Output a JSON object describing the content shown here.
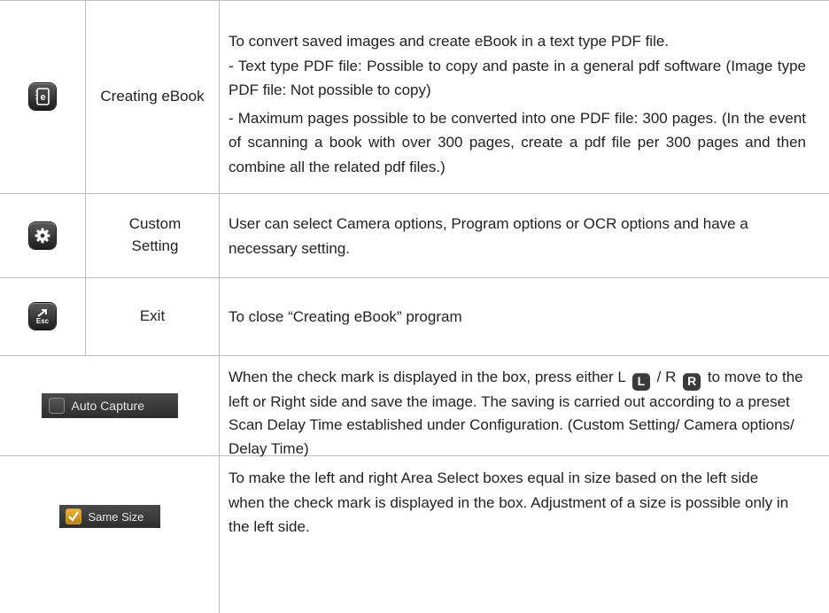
{
  "rows": [
    {
      "icon": "ebook-icon",
      "label": "Creating eBook",
      "desc": [
        "To convert saved images and create eBook in a text type PDF file.",
        "- Text type PDF file: Possible to copy and paste in a general pdf software (Image type PDF file: Not possible to copy)",
        "- Maximum pages possible to be converted into one PDF file: 300 pages. (In the event of scanning a book with over 300 pages, create a pdf file per 300 pages and then combine all the related pdf files.)"
      ]
    },
    {
      "icon": "gear-icon",
      "label": "Custom Setting",
      "desc": "User can select Camera options, Program options or OCR options and have a necessary setting."
    },
    {
      "icon": "esc-exit-icon",
      "label": "Exit",
      "desc": "To close “Creating eBook” program"
    },
    {
      "control_label": "Auto Capture",
      "checked": false,
      "desc_part1": "When the check mark is displayed in the box, press either L",
      "key_left": "L",
      "sep": "/ R",
      "key_right": "R",
      "desc_part2": "to move to the left or Right side and save the image. The saving is carried out according to a preset Scan Delay Time established under Configuration.  (Custom Setting/ Camera options/ Delay Time)"
    },
    {
      "control_label": "Same Size",
      "checked": true,
      "desc": "To make the left and right Area Select boxes equal in size based on the left side when the check mark is displayed in the box. Adjustment of a size is possible only in the left side."
    }
  ],
  "colors": {
    "grid": "#bdbdbd",
    "checkbox_checked": "#d69e24",
    "control_bg": "#3a3a3a"
  }
}
